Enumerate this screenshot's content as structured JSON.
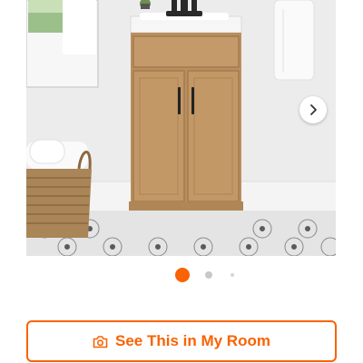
{
  "product_gallery": {
    "image_count": 3,
    "active_index": 1,
    "next_icon": "chevron-right-icon"
  },
  "room_button": {
    "label": "See This in My Room",
    "icon": "camera-icon"
  },
  "colors": {
    "accent": "#f96302",
    "dot_inactive": "#c8c8c8",
    "dot_small": "#d4d4d4"
  }
}
